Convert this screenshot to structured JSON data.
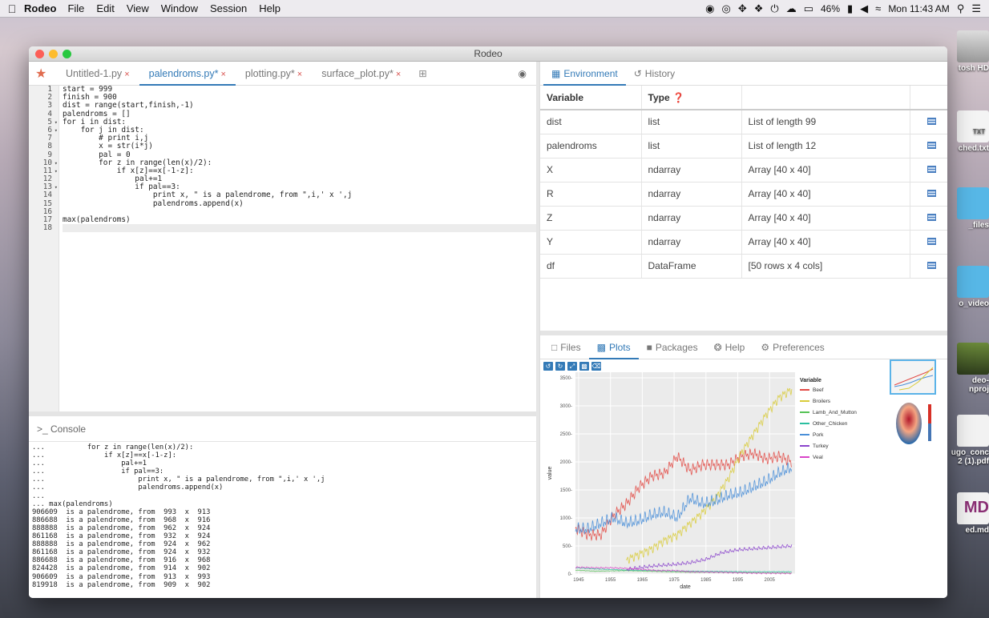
{
  "menubar": {
    "apple": "",
    "app": "Rodeo",
    "items": [
      "File",
      "Edit",
      "View",
      "Window",
      "Session",
      "Help"
    ],
    "battery": "46%",
    "clock": "Mon 11:43 AM"
  },
  "desktop": {
    "items": [
      "tosh HD",
      "ched.txt",
      "_files",
      "o_video",
      "deo-\nnproj",
      "ugo_conc\n2 (1).pdf",
      "ed.md"
    ],
    "txt_badge": "TXT",
    "md_badge": "MD"
  },
  "window": {
    "title": "Rodeo"
  },
  "editor": {
    "tabs": [
      {
        "label": "Untitled-1.py",
        "close": "×",
        "active": false
      },
      {
        "label": "palendroms.py*",
        "close": "×",
        "active": true
      },
      {
        "label": "plotting.py*",
        "close": "×",
        "active": false
      },
      {
        "label": "surface_plot.py*",
        "close": "×",
        "active": false
      }
    ],
    "lines": [
      {
        "n": "1",
        "code": "start = 999"
      },
      {
        "n": "2",
        "code": "finish = 900"
      },
      {
        "n": "3",
        "code": "dist = range(start,finish,-1)"
      },
      {
        "n": "4",
        "code": "palendroms = []"
      },
      {
        "n": "5",
        "code": "for i in dist:",
        "fold": true
      },
      {
        "n": "6",
        "code": "    for j in dist:",
        "fold": true
      },
      {
        "n": "7",
        "code": "        # print i,j"
      },
      {
        "n": "8",
        "code": "        x = str(i*j)"
      },
      {
        "n": "9",
        "code": "        pal = 0"
      },
      {
        "n": "10",
        "code": "        for z in range(len(x)/2):",
        "fold": true
      },
      {
        "n": "11",
        "code": "            if x[z]==x[-1-z]:",
        "fold": true
      },
      {
        "n": "12",
        "code": "                pal+=1"
      },
      {
        "n": "13",
        "code": "                if pal==3:",
        "fold": true
      },
      {
        "n": "14",
        "code": "                    print x, \" is a palendrome, from \",i,' x ',j"
      },
      {
        "n": "15",
        "code": "                    palendroms.append(x)"
      },
      {
        "n": "16",
        "code": ""
      },
      {
        "n": "17",
        "code": "max(palendroms)"
      },
      {
        "n": "18",
        "code": ""
      }
    ]
  },
  "console": {
    "header": ">_ Console",
    "lines": [
      "...          for z in range(len(x)/2):",
      "...              if x[z]==x[-1-z]:",
      "...                  pal+=1",
      "...                  if pal==3:",
      "...                      print x, \" is a palendrome, from \",i,' x ',j",
      "...                      palendroms.append(x)",
      "...",
      "... max(palendroms)",
      "906609  is a palendrome, from  993  x  913",
      "886688  is a palendrome, from  968  x  916",
      "888888  is a palendrome, from  962  x  924",
      "861168  is a palendrome, from  932  x  924",
      "888888  is a palendrome, from  924  x  962",
      "861168  is a palendrome, from  924  x  932",
      "886688  is a palendrome, from  916  x  968",
      "824428  is a palendrome, from  914  x  902",
      "906609  is a palendrome, from  913  x  993",
      "819918  is a palendrome, from  909  x  902"
    ]
  },
  "environment": {
    "tabs": [
      "Environment",
      "History"
    ],
    "headers": {
      "variable": "Variable",
      "type": "Type"
    },
    "rows": [
      {
        "name": "dist",
        "type": "list",
        "value": "List of length 99"
      },
      {
        "name": "palendroms",
        "type": "list",
        "value": "List of length 12"
      },
      {
        "name": "X",
        "type": "ndarray",
        "value": "Array [40 x 40]"
      },
      {
        "name": "R",
        "type": "ndarray",
        "value": "Array [40 x 40]"
      },
      {
        "name": "Z",
        "type": "ndarray",
        "value": "Array [40 x 40]"
      },
      {
        "name": "Y",
        "type": "ndarray",
        "value": "Array [40 x 40]"
      },
      {
        "name": "df",
        "type": "DataFrame",
        "value": "[50 rows x 4 cols]"
      }
    ]
  },
  "lowertabs": [
    "Files",
    "Plots",
    "Packages",
    "Help",
    "Preferences"
  ],
  "colors": {
    "accent": "#337ab7",
    "beef": "#e24a45",
    "broilers": "#d9cc3a",
    "lamb": "#55c255",
    "chicken": "#2bbfa0",
    "pork": "#4a8fd8",
    "turkey": "#8a44cc",
    "veal": "#d844c8"
  },
  "chart_data": {
    "type": "line",
    "xlabel": "date",
    "ylabel": "value",
    "x_ticks": [
      "1945",
      "1955",
      "1965",
      "1975",
      "1985",
      "1995",
      "2005"
    ],
    "y_ticks": [
      "0",
      "500",
      "1000",
      "1500",
      "2000",
      "2500",
      "3000",
      "3500"
    ],
    "xlim": [
      1944,
      2013
    ],
    "ylim": [
      0,
      3600
    ],
    "legend_title": "Variable",
    "legend_position": "right",
    "grid": true,
    "series": [
      {
        "name": "Beef",
        "color": "#e24a45",
        "x": [
          1944,
          1948,
          1952,
          1956,
          1960,
          1964,
          1968,
          1972,
          1976,
          1980,
          1984,
          1988,
          1992,
          1996,
          2000,
          2004,
          2008,
          2012
        ],
        "values": [
          820,
          700,
          700,
          1050,
          1250,
          1550,
          1750,
          1800,
          2100,
          1850,
          1950,
          1950,
          1950,
          2100,
          2150,
          2050,
          2100,
          2000
        ]
      },
      {
        "name": "Broilers",
        "color": "#d9cc3a",
        "x": [
          1960,
          1964,
          1968,
          1972,
          1976,
          1980,
          1984,
          1988,
          1992,
          1996,
          2000,
          2004,
          2008,
          2012
        ],
        "values": [
          250,
          350,
          450,
          600,
          700,
          900,
          1100,
          1350,
          1700,
          2150,
          2500,
          2850,
          3150,
          3300
        ]
      },
      {
        "name": "Lamb_And_Mutton",
        "color": "#55c255",
        "x": [
          1944,
          1950,
          1960,
          1970,
          1980,
          1990,
          2000,
          2012
        ],
        "values": [
          70,
          50,
          60,
          45,
          30,
          30,
          20,
          15
        ]
      },
      {
        "name": "Other_Chicken",
        "color": "#2bbfa0",
        "x": [
          1944,
          1950,
          1960,
          1970,
          1980,
          1990,
          2000,
          2012
        ],
        "values": [
          110,
          90,
          70,
          60,
          50,
          45,
          40,
          40
        ]
      },
      {
        "name": "Pork",
        "color": "#4a8fd8",
        "x": [
          1944,
          1948,
          1952,
          1956,
          1960,
          1964,
          1968,
          1972,
          1976,
          1980,
          1984,
          1988,
          1992,
          1996,
          2000,
          2004,
          2008,
          2012
        ],
        "values": [
          800,
          800,
          900,
          1000,
          900,
          950,
          1050,
          1100,
          1000,
          1350,
          1250,
          1300,
          1400,
          1450,
          1550,
          1650,
          1800,
          1900
        ]
      },
      {
        "name": "Turkey",
        "color": "#8a44cc",
        "x": [
          1960,
          1965,
          1970,
          1975,
          1980,
          1985,
          1990,
          1995,
          2000,
          2005,
          2012
        ],
        "values": [
          80,
          120,
          150,
          170,
          200,
          260,
          380,
          430,
          450,
          470,
          500
        ]
      },
      {
        "name": "Veal",
        "color": "#d844c8",
        "x": [
          1944,
          1950,
          1955,
          1960,
          1965,
          1970,
          1975,
          1980,
          1990,
          2000,
          2012
        ],
        "values": [
          120,
          110,
          110,
          100,
          80,
          60,
          60,
          40,
          30,
          15,
          10
        ]
      }
    ]
  }
}
